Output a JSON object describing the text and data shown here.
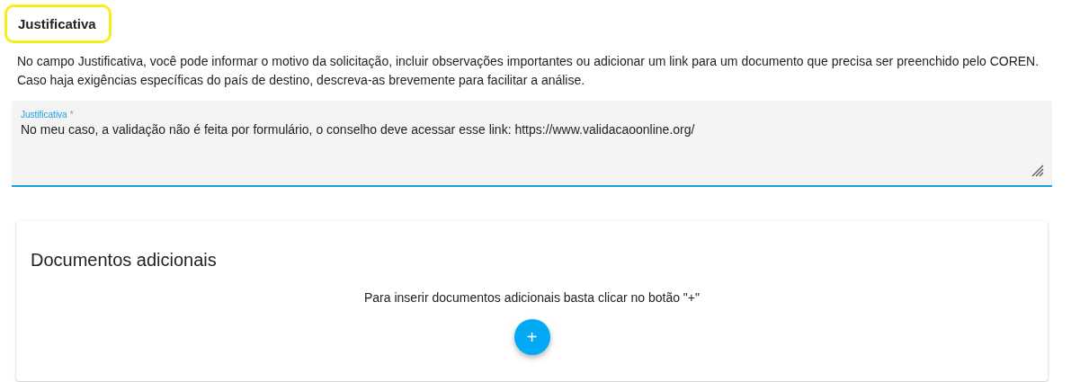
{
  "justificativa": {
    "heading": "Justificativa",
    "highlighted": true,
    "description": [
      "No campo Justificativa, você pode informar o motivo da solicitação, incluir observações importantes ou adicionar um link para um documento que precisa ser preenchido pelo COREN.",
      "Caso haja exigências específicas do país de destino, descreva-as brevemente para facilitar a análise."
    ],
    "field": {
      "label": "Justificativa",
      "required_mark": "*",
      "value": "No meu caso, a validação não é feita por formulário, o conselho deve acessar esse link: https://www.validacaoonline.org/",
      "focused": true
    }
  },
  "documentos": {
    "title": "Documentos adicionais",
    "hint": "Para inserir documentos adicionais basta clicar no botão \"+\"",
    "add_button": "+"
  }
}
